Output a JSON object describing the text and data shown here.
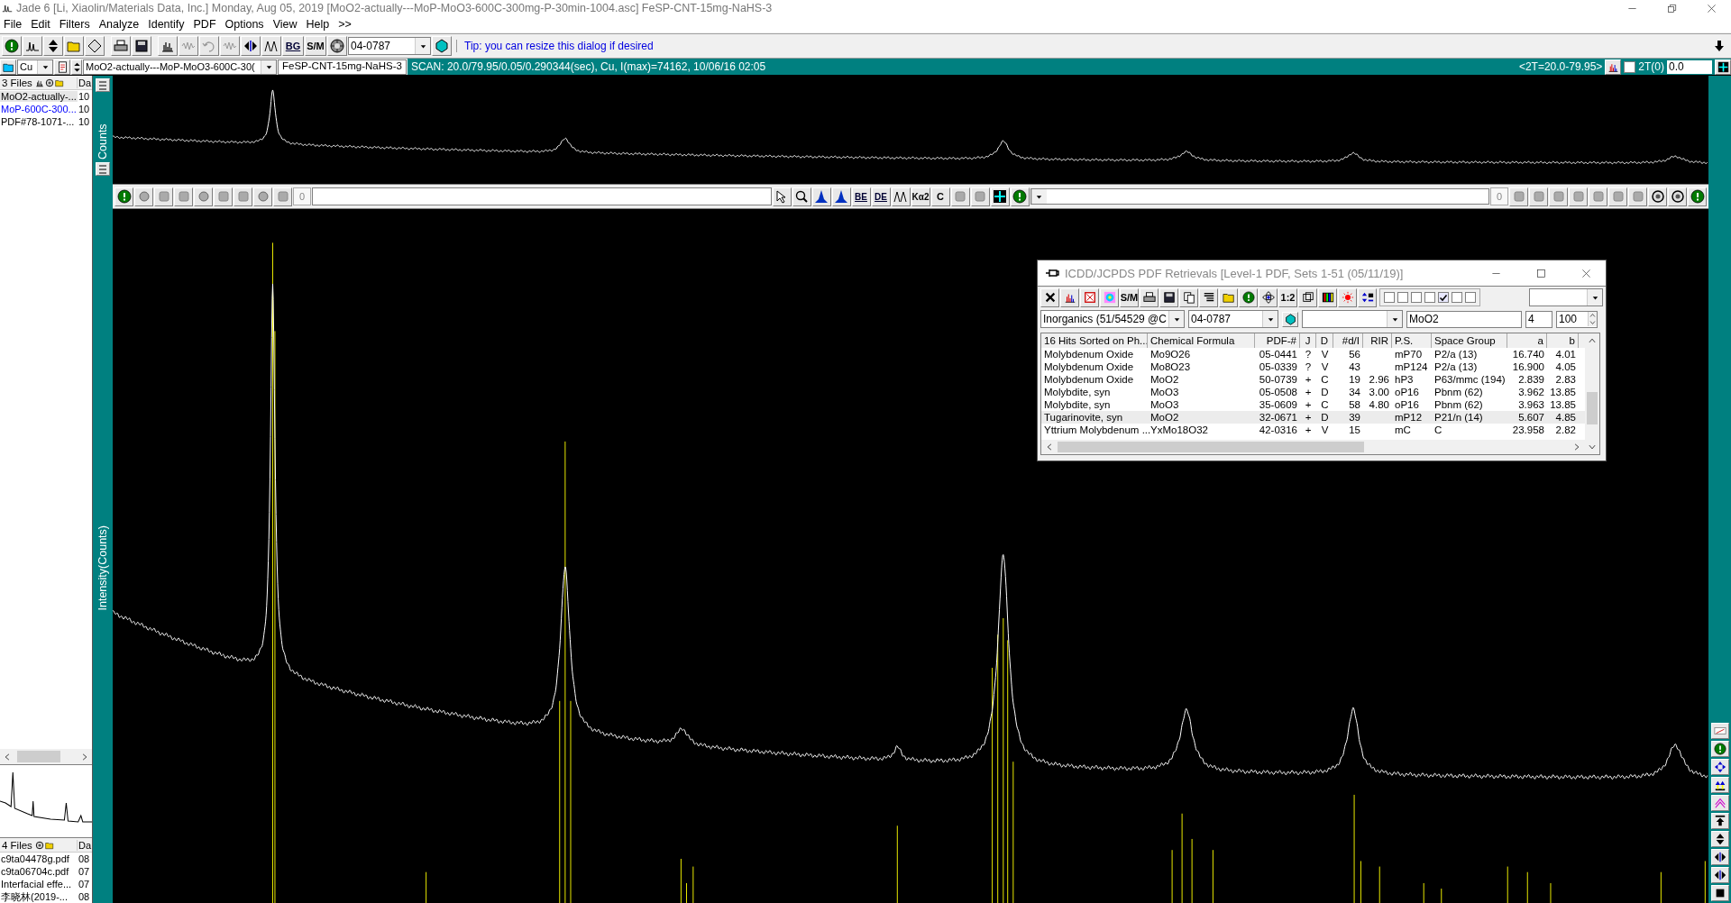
{
  "window": {
    "title": "Jade 6 [Li,  Xiaolin/Materials Data, Inc.] Monday, Aug 05, 2019 [MoO2-actually---MoP-MoO3-600C-300mg-P-30min-1004.asc] FeSP-CNT-15mg-NaHS-3"
  },
  "menu": [
    {
      "label": "File"
    },
    {
      "label": "Edit"
    },
    {
      "label": "Filters"
    },
    {
      "label": "Analyze"
    },
    {
      "label": "Identify"
    },
    {
      "label": "PDF"
    },
    {
      "label": "Options"
    },
    {
      "label": "View"
    },
    {
      "label": "Help"
    },
    {
      "label": ">>"
    }
  ],
  "toolbar": {
    "bg_label": "BG",
    "sm_label": "S/M",
    "pdf_number": "04-0787",
    "tip": "Tip: you can resize this dialog if desired"
  },
  "scan_bar": {
    "radiation": "Cu",
    "file": "MoO2-actually---MoP-MoO3-600C-30(",
    "sample": "FeSP-CNT-15mg-NaHS-3",
    "scan": "SCAN: 20.0/79.95/0.05/0.290344(sec), Cu, I(max)=74162, 10/06/16 02:05",
    "range": "<2T=20.0-79.95>",
    "offset_checked": false,
    "offset_label": "2T(0)",
    "offset_value": "0.0"
  },
  "files_panel": {
    "header": "3 Files",
    "column_2": "Da",
    "rows": [
      {
        "name": "MoO2-actually-...",
        "column_2": "10",
        "selected": true,
        "color": "#000000"
      },
      {
        "name": "MoP-600C-300...",
        "column_2": "10",
        "selected": false,
        "color": "#0000ff"
      },
      {
        "name": "PDF#78-1071-...",
        "column_2": "10",
        "selected": false,
        "color": "#000000"
      }
    ]
  },
  "documents_panel": {
    "header": "4 Files",
    "column_2": "Da",
    "rows": [
      {
        "name": "c9ta04478g.pdf",
        "column_2": "08"
      },
      {
        "name": "c9ta06704c.pdf",
        "column_2": "07"
      },
      {
        "name": "Interfacial effe...",
        "column_2": "07"
      },
      {
        "name": "李晓林(2019-...",
        "column_2": "08"
      }
    ]
  },
  "plot": {
    "top_ylabel": "Counts",
    "main_ylabel": "Intensity(Counts)"
  },
  "plot_toolbar": {
    "left_value": "0",
    "be_label": "BE",
    "de_label": "DE",
    "ka_label": "Kα2",
    "c_label": "C",
    "right_value": "0"
  },
  "dialog": {
    "title": "ICDD/JCPDS PDF Retrievals [Level-1 PDF, Sets 1-51 (05/11/19)]",
    "sm_label": "S/M",
    "ratio_label": "1:2",
    "checkboxes": [
      {
        "checked": false
      },
      {
        "checked": false
      },
      {
        "checked": false
      },
      {
        "checked": false
      },
      {
        "checked": true
      },
      {
        "checked": false
      },
      {
        "checked": false
      }
    ],
    "database": "Inorganics (51/54529 @C",
    "pdf_number": "04-0787",
    "formula": "MoO2",
    "field_4": "4",
    "field_5": "100",
    "columns": [
      "16 Hits Sorted on Ph...",
      "Chemical Formula",
      "PDF-#",
      "J",
      "D",
      "#d/I",
      "RIR",
      "P.S.",
      "Space Group",
      "a",
      "b"
    ],
    "rows": [
      {
        "cells": [
          "Molybdenum Oxide",
          "Mo9O26",
          "05-0441",
          "?",
          "V",
          "56",
          "",
          "mP70",
          "P2/a (13)",
          "16.740",
          "4.01"
        ],
        "selected": false
      },
      {
        "cells": [
          "Molybdenum Oxide",
          "Mo8O23",
          "05-0339",
          "?",
          "V",
          "43",
          "",
          "mP124",
          "P2/a (13)",
          "16.900",
          "4.05"
        ],
        "selected": false
      },
      {
        "cells": [
          "Molybdenum Oxide",
          "MoO2",
          "50-0739",
          "+",
          "C",
          "19",
          "2.96",
          "hP3",
          "P63/mmc (194)",
          "2.839",
          "2.83"
        ],
        "selected": false
      },
      {
        "cells": [
          "Molybdite, syn",
          "MoO3",
          "05-0508",
          "+",
          "D",
          "34",
          "3.00",
          "oP16",
          "Pbnm (62)",
          "3.962",
          "13.85"
        ],
        "selected": false
      },
      {
        "cells": [
          "Molybdite, syn",
          "MoO3",
          "35-0609",
          "+",
          "C",
          "58",
          "4.80",
          "oP16",
          "Pbnm (62)",
          "3.963",
          "13.85"
        ],
        "selected": false
      },
      {
        "cells": [
          "Tugarinovite, syn",
          "MoO2",
          "32-0671",
          "+",
          "D",
          "39",
          "",
          "mP12",
          "P21/n (14)",
          "5.607",
          "4.85"
        ],
        "selected": true
      },
      {
        "cells": [
          "Yttrium Molybdenum ...",
          "YxMo18O32",
          "42-0316",
          "+",
          "V",
          "15",
          "",
          "mC",
          "C",
          "23.958",
          "2.82"
        ],
        "selected": false
      }
    ]
  }
}
